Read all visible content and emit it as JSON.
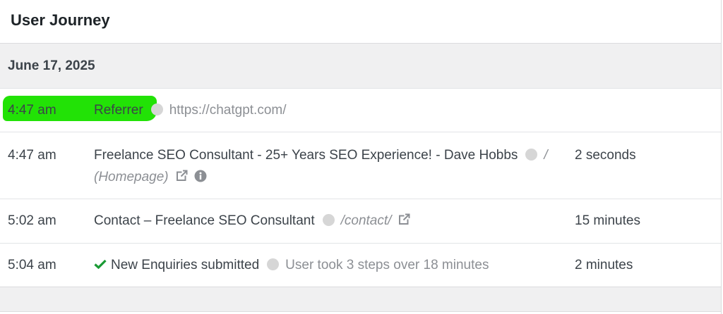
{
  "header": {
    "title": "User Journey"
  },
  "date": "June 17, 2025",
  "rows": [
    {
      "time": "4:47 am",
      "title": "Referrer",
      "meta": "https://chatgpt.com/",
      "duration": ""
    },
    {
      "time": "4:47 am",
      "title": "Freelance SEO Consultant - 25+ Years SEO Experience! - Dave Hobbs",
      "path": "/",
      "path_label": "(Homepage)",
      "duration": "2 seconds"
    },
    {
      "time": "5:02 am",
      "title": "Contact – Freelance SEO Consultant",
      "path": "/contact/",
      "duration": "15 minutes"
    },
    {
      "time": "5:04 am",
      "title": "New Enquiries submitted",
      "meta": "User took 3 steps over 18 minutes",
      "duration": "2 minutes"
    }
  ],
  "colors": {
    "highlight": "#22e206",
    "check": "#1a9a34",
    "muted": "#8c8f94",
    "dot": "#d6d6d6"
  },
  "icons": [
    "external-link-icon",
    "info-icon",
    "check-icon",
    "status-dot-icon"
  ]
}
